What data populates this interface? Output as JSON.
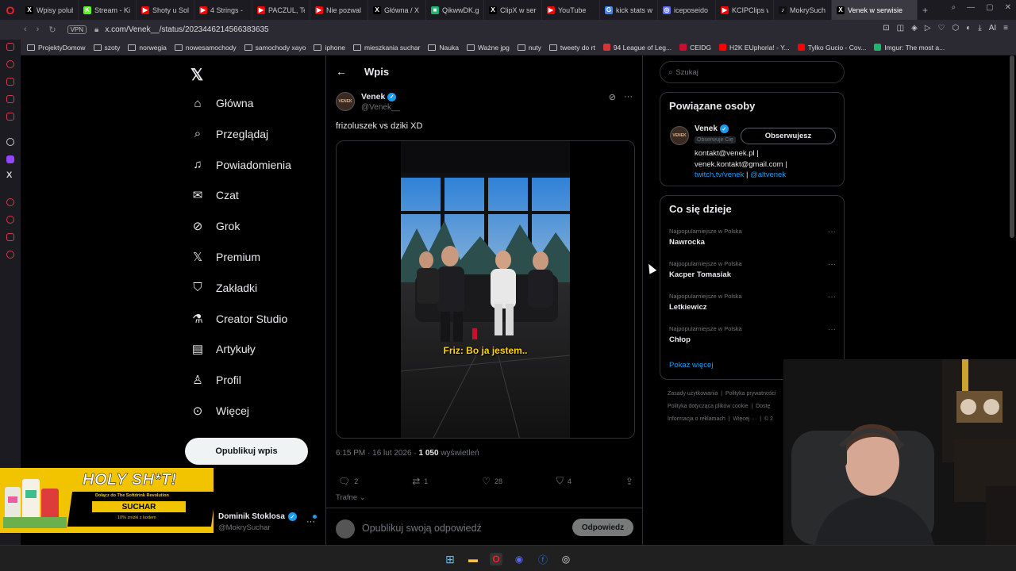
{
  "browser": {
    "tabs": [
      {
        "label": "Wpisy polub",
        "fav": "X",
        "color": "#000000"
      },
      {
        "label": "Stream - Ki",
        "fav": "K",
        "color": "#53fc18"
      },
      {
        "label": "Shoty u Sol",
        "fav": "▶",
        "color": "#ff0000"
      },
      {
        "label": "4 Strings -",
        "fav": "▶",
        "color": "#ff0000"
      },
      {
        "label": "PACZUL, Te",
        "fav": "▶",
        "color": "#ff0000"
      },
      {
        "label": "Nie pozwal",
        "fav": "▶",
        "color": "#ff0000"
      },
      {
        "label": "Główna / X",
        "fav": "X",
        "color": "#000000"
      },
      {
        "label": "QikwwDK.g",
        "fav": "■",
        "color": "#1bb76e"
      },
      {
        "label": "ClipX w ser",
        "fav": "X",
        "color": "#000000"
      },
      {
        "label": "YouTube",
        "fav": "▶",
        "color": "#ff0000"
      },
      {
        "label": "kick stats w",
        "fav": "G",
        "color": "#4285f4"
      },
      {
        "label": "iceposeido",
        "fav": "◎",
        "color": "#5b6cff"
      },
      {
        "label": "KCIPClips w",
        "fav": "▶",
        "color": "#ff0000"
      },
      {
        "label": "MokrySuch",
        "fav": "♪",
        "color": "#111111"
      },
      {
        "label": "Venek w serwisie",
        "fav": "X",
        "color": "#000000",
        "active": true
      }
    ],
    "url": "x.com/Venek__/status/2023446214566383635",
    "vpn_label": "VPN",
    "ai_label": "AI",
    "bookmarks": [
      {
        "label": "ProjektyDomow",
        "kind": "folder"
      },
      {
        "label": "szoty",
        "kind": "folder"
      },
      {
        "label": "norwegia",
        "kind": "folder"
      },
      {
        "label": "nowesamochody",
        "kind": "folder"
      },
      {
        "label": "samochody xayo",
        "kind": "folder"
      },
      {
        "label": "iphone",
        "kind": "folder"
      },
      {
        "label": "mieszkania suchar",
        "kind": "folder"
      },
      {
        "label": "Nauka",
        "kind": "folder"
      },
      {
        "label": "Ważne jpg",
        "kind": "folder"
      },
      {
        "label": "nuty",
        "kind": "folder"
      },
      {
        "label": "tweety do rt",
        "kind": "folder"
      },
      {
        "label": "94 League of Leg...",
        "kind": "site",
        "color": "#d13639"
      },
      {
        "label": "CEIDG",
        "kind": "site",
        "color": "#c8102e"
      },
      {
        "label": "H2K EUphoria! - Y...",
        "kind": "site",
        "color": "#ff0000"
      },
      {
        "label": "Tylko Gucio - Cov...",
        "kind": "site",
        "color": "#ff0000"
      },
      {
        "label": "Imgur: The most a...",
        "kind": "site",
        "color": "#1bb76e"
      }
    ]
  },
  "nav": {
    "items": [
      {
        "label": "Główna",
        "icon": "home-icon"
      },
      {
        "label": "Przeglądaj",
        "icon": "search-icon"
      },
      {
        "label": "Powiadomienia",
        "icon": "bell-icon"
      },
      {
        "label": "Czat",
        "icon": "mail-icon"
      },
      {
        "label": "Grok",
        "icon": "grok-icon"
      },
      {
        "label": "Premium",
        "icon": "x-premium-icon"
      },
      {
        "label": "Zakładki",
        "icon": "bookmark-icon"
      },
      {
        "label": "Creator Studio",
        "icon": "flask-icon"
      },
      {
        "label": "Artykuły",
        "icon": "article-icon"
      },
      {
        "label": "Profil",
        "icon": "person-icon"
      },
      {
        "label": "Więcej",
        "icon": "more-icon"
      }
    ],
    "post_button": "Opublikuj wpis"
  },
  "promo": {
    "headline": "HOLY SH*T!",
    "line1": "Dołącz do The Softdrink Revolution",
    "code": "SUCHAR",
    "line3": "10% zniżki z kodem"
  },
  "account": {
    "name": "Dominik Stoklosa",
    "handle": "@MokrySuchar"
  },
  "post": {
    "header_title": "Wpis",
    "author_name": "Venek",
    "author_handle": "@Venek__",
    "avatar_text": "VENEK",
    "text": "frizoluszek vs dziki XD",
    "subtitle": "Friz: Bo ja jestem..",
    "time": "6:15 PM · 16 lut 2026 · ",
    "views": "1 050",
    "views_label": " wyświetleń",
    "replies": "2",
    "reposts": "1",
    "likes": "28",
    "bookmarks": "4",
    "sort_label": "Trafne",
    "reply_placeholder": "Opublikuj swoją odpowiedź",
    "reply_button": "Odpowiedz"
  },
  "right": {
    "search_placeholder": "Szukaj",
    "related": {
      "title": "Powiązane osoby",
      "name": "Venek",
      "follows_you": "Obserwuje Cię",
      "follow_button": "Obserwujesz",
      "bio_line1": "kontakt@venek.pl |",
      "bio_line2": "venek.kontakt@gmail.com |",
      "bio_link1": "twitch.tv/venek",
      "bio_sep": " | ",
      "bio_link2": "@altvenek"
    },
    "trends": {
      "title": "Co się dzieje",
      "items": [
        {
          "category": "Najpopularniejsze w Polska",
          "name": "Nawrocka"
        },
        {
          "category": "Najpopularniejsze w Polska",
          "name": "Kacper Tomasiak"
        },
        {
          "category": "Najpopularniejsze w Polska",
          "name": "Letkiewicz"
        },
        {
          "category": "Najpopularniejsze w Polska",
          "name": "Chłop"
        }
      ],
      "show_more": "Pokaż więcej"
    },
    "footer": {
      "line1a": "Zasady użytkowania",
      "line1b": "Polityka prywatności",
      "line2a": "Polityka dotycząca plików cookie",
      "line2b": "Dostę",
      "line3a": "Informacja o reklamach",
      "line3b": "Więcej ···",
      "line3c": "© 2"
    }
  }
}
